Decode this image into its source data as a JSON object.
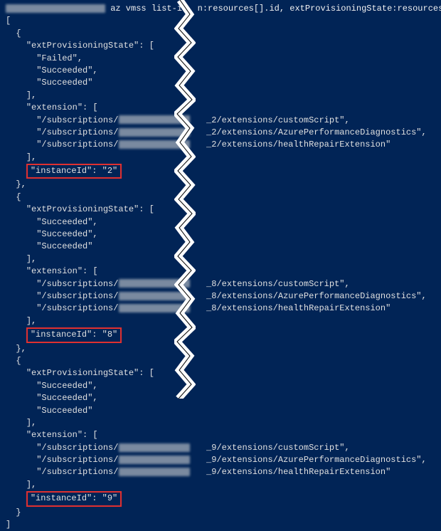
{
  "prompt_cmd": "az vmss list-i",
  "prompt_cmd_after": "n:resources[].id, extProvisioningState:resources[]",
  "bracket_open": "[",
  "bracket_close": "]",
  "brace_open": "{",
  "brace_close": "}",
  "brace_close_comma": "},",
  "close_sq_comma": "],",
  "ext_prov_key": "\"extProvisioningState\": [",
  "extension_key": "\"extension\": [",
  "status_failed": "\"Failed\",",
  "status_succeeded_c": "\"Succeeded\",",
  "status_succeeded": "\"Succeeded\"",
  "sub_prefix": "\"/subscriptions/",
  "instances": [
    {
      "id_key": "\"instanceId\": \"2\"",
      "statuses": [
        "failed",
        "succeeded_c",
        "succeeded"
      ],
      "ext_suffix_1": "_2/extensions/customScript\",",
      "ext_suffix_2": "_2/extensions/AzurePerformanceDiagnostics\",",
      "ext_suffix_3": "_2/extensions/healthRepairExtension\""
    },
    {
      "id_key": "\"instanceId\": \"8\"",
      "statuses": [
        "succeeded_c",
        "succeeded_c",
        "succeeded"
      ],
      "ext_suffix_1": "_8/extensions/customScript\",",
      "ext_suffix_2": "_8/extensions/AzurePerformanceDiagnostics\",",
      "ext_suffix_3": "_8/extensions/healthRepairExtension\""
    },
    {
      "id_key": "\"instanceId\": \"9\"",
      "statuses": [
        "succeeded_c",
        "succeeded_c",
        "succeeded"
      ],
      "ext_suffix_1": "_9/extensions/customScript\",",
      "ext_suffix_2": "_9/extensions/AzurePerformanceDiagnostics\",",
      "ext_suffix_3": "_9/extensions/healthRepairExtension\""
    }
  ]
}
